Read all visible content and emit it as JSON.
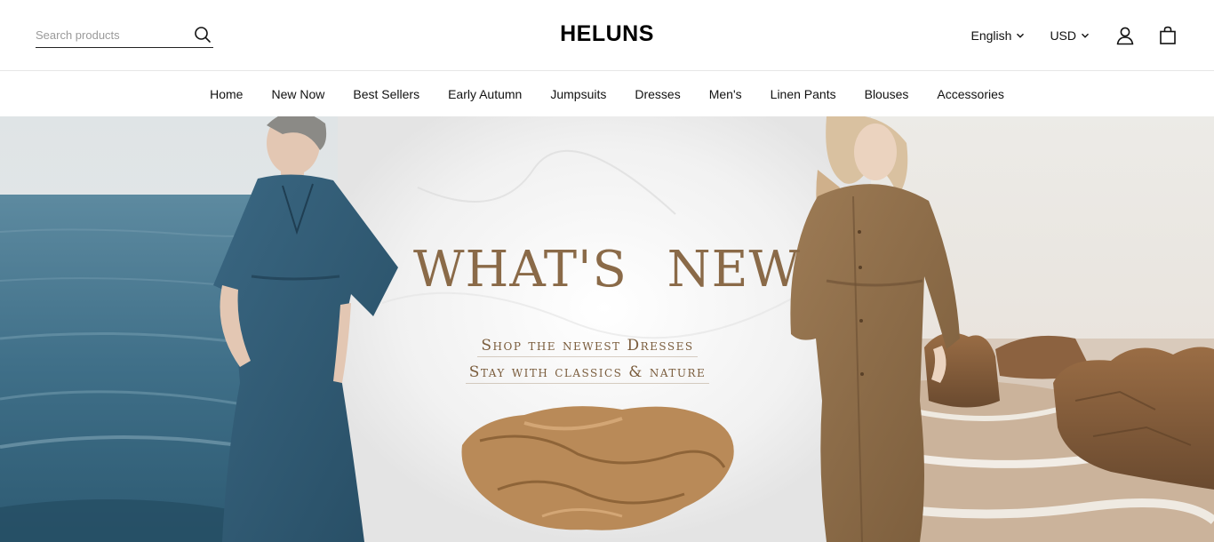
{
  "header": {
    "search_placeholder": "Search products",
    "logo": "HELUNS",
    "language": "English",
    "currency": "USD"
  },
  "icons": {
    "search": "search-icon",
    "chevron": "chevron-down-icon",
    "account": "user-icon",
    "cart": "shopping-bag-icon"
  },
  "nav": {
    "items": [
      "Home",
      "New Now",
      "Best Sellers",
      "Early Autumn",
      "Jumpsuits",
      "Dresses",
      "Men's",
      "Linen Pants",
      "Blouses",
      "Accessories"
    ]
  },
  "hero": {
    "title": "WHAT'S NEW",
    "line1": "Shop the newest Dresses",
    "line2": "Stay with classics & nature"
  },
  "colors": {
    "brand_text": "#000000",
    "hero_text": "#8a6a48",
    "sea": "#3f6f88",
    "blue_dress": "#2f5872",
    "brown_dress": "#8b6c49"
  }
}
